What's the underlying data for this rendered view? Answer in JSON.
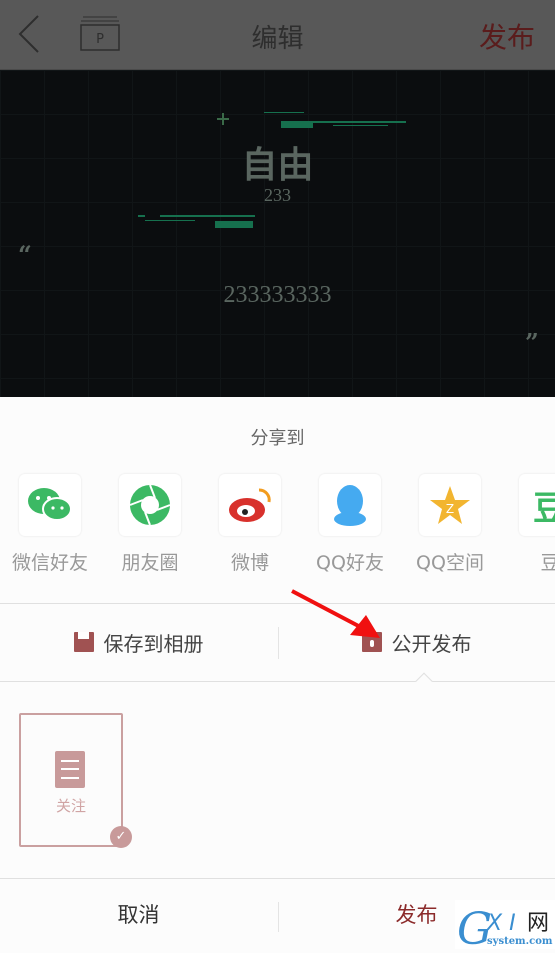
{
  "header": {
    "title": "编辑",
    "publish_label": "发布",
    "p_icon_letter": "P"
  },
  "preview": {
    "title": "自由",
    "subtitle": "233",
    "body": "233333333",
    "open_quote": "“",
    "close_quote": "”"
  },
  "share": {
    "label": "分享到",
    "items": [
      {
        "label": "微信好友",
        "icon": "wechat-icon",
        "color": "#3cb964"
      },
      {
        "label": "朋友圈",
        "icon": "moments-icon",
        "color": "#3cb964"
      },
      {
        "label": "微博",
        "icon": "weibo-icon",
        "color": "#d8312c"
      },
      {
        "label": "QQ好友",
        "icon": "qq-icon",
        "color": "#45aaf0"
      },
      {
        "label": "QQ空间",
        "icon": "qzone-icon",
        "color": "#f2b530"
      },
      {
        "label": "豆",
        "icon": "douban-icon",
        "color": "#3cb964"
      }
    ]
  },
  "actions": {
    "save": "保存到相册",
    "public": "公开发布"
  },
  "templates": [
    {
      "label": "关注",
      "selected": true
    }
  ],
  "footer": {
    "cancel": "取消",
    "publish": "发布"
  },
  "colors": {
    "accent": "#8b2a2a",
    "template": "#c89a9a"
  },
  "watermark": {
    "text": "GXI网",
    "sub": "system.com"
  }
}
